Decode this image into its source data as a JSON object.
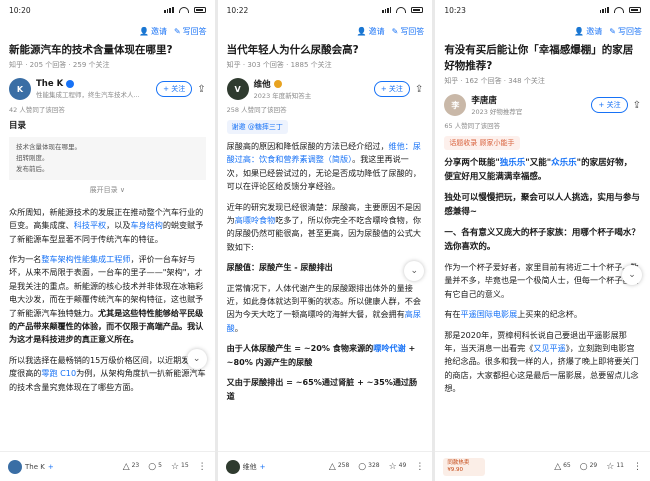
{
  "screens": [
    {
      "time": "10:20",
      "invite": "邀请",
      "write": "写回答",
      "question": "新能源汽车的技术含量体现在哪里?",
      "meta": "知乎 · 205 个回答 · 259 个关注",
      "author": "The K",
      "author_desc": "性能集成工程师，终生汽车技术人...",
      "follow": "+ 关注",
      "approve": "42 人赞同了该回答",
      "toc_title": "目录",
      "toc_items": [
        "技术含量体现在哪里。",
        "扭转刚度。",
        "发布前后。"
      ],
      "expand": "展开目录 ∨",
      "p1a": "众所周知，新能源技术的发展正在推动整个汽车行业的巨变。高集成度、",
      "p1_l1": "科技平权",
      "p1b": "，以及",
      "p1_l2": "车身结构",
      "p1c": "的蜕变赋予了新能源车型显著不同于传统汽车的特征。",
      "p2a": "作为一名",
      "p2_l1": "整车架构性能集成工程师",
      "p2b": "，评价一台车好与坏，从来不局限于表面，一台车的里子——\"架构\"，才是我关注的重点。新能源的核心技术并非体现在冰箱彩电大沙发，而在于颠覆传统汽车的架构特征，这也赋予了新能源汽车独特魅力。",
      "p2c": "尤其是这些特性能够给平民级的产品带来颠覆性的体验，而不仅限于高端产品。我认为这才是科技进步的真正意义所在。",
      "p3a": "所以我选择在最畅销的15万级价格区间，以近期发布热度很高的",
      "p3_l1": "零跑 C10",
      "p3b": "为例，从架构角度扒一扒新能源汽车的技术含量究竟体现在了哪些方面。",
      "bot_name": "The K",
      "bot_plus": "+",
      "bot_up": "23",
      "bot_comments": "5",
      "bot_stars": "15"
    },
    {
      "time": "10:22",
      "invite": "邀请",
      "write": "写回答",
      "question": "当代年轻人为什么尿酸会高?",
      "meta": "知乎 · 303 个回答 · 1885 个关注",
      "author": "维他",
      "author_desc": "2023 年度新知答主",
      "follow": "+ 关注",
      "approve": "258 人赞同了该回答",
      "mention": "谢邀 @糖摔三丁",
      "p1a": "尿酸高的原因和降低尿酸的方法已经介绍过，",
      "p1_l1": "维他：尿酸过高：饮食和营养素调整（简版）",
      "p1b": "。我这里再说一次，如果已经尝试过的，无论是否成功降低了尿酸的，可以在评论区给反馈分享经验。",
      "p2a": "近年的研究发现已经很清楚：尿酸高，主要原因不是因为",
      "p2_l1": "高嘌呤食物",
      "p2b": "吃多了，所以你完全不吃含嘌呤食物，你的尿酸仍然可能很高，甚至更高，因为尿酸值的公式大致如下:",
      "formula": "尿酸值：尿酸产生 - 尿酸排出",
      "p3a": "正常情况下，人体代谢产生的尿酸跟排出体外的量接近，如此身体就达到平衡的状态。所以健康人群，不会因为今天大吃了一顿高嘌呤的海鲜大餐，就会拥有",
      "p3_l1": "高尿酸",
      "p3b": "。",
      "p4a": "由于人体尿酸产生 = ~20% 食物来源的",
      "p4_l1": "嘌呤代谢",
      "p4b": " + ~80% 内源产生的尿酸",
      "p5": "又由于尿酸排出 = ~65%通过肾脏 + ~35%通过肠道",
      "bot_name": "维他",
      "bot_plus": "+",
      "bot_up": "258",
      "bot_comments": "328",
      "bot_stars": "49"
    },
    {
      "time": "10:23",
      "invite": "邀请",
      "write": "写回答",
      "question": "有没有买后能让你「幸福感爆棚」的家居好物推荐?",
      "meta": "知乎 · 162 个回答 · 348 个关注",
      "author": "李唐唐",
      "author_desc": "2023 好物推荐官",
      "follow": "+ 关注",
      "approve": "65 人赞同了该回答",
      "topic_tag": "话题收录 顾家小能手",
      "p1a": "分享两个既能\"",
      "p1_l1": "独乐乐",
      "p1b": "\"又能\"",
      "p1_l2": "众乐乐",
      "p1c": "\"的家居好物，",
      "p1d": "便宜好用又能满满幸福感。",
      "p2": "独处可以慢慢把玩，聚会可以人人挑选，实用与参与感兼得~",
      "h1": "一、各有意义又庞大的杯子家族：用哪个杯子喝水？选你喜欢的。",
      "p3": "作为一个杯子爱好者，家里目前有将近二十个杯子。数量并不多，毕竟也是一个极简人士，但每一个杯子都具有它自己的意义。",
      "p4a": "有在",
      "p4_l1": "平遥国际电影展",
      "p4b": "上买来的纪念杯。",
      "p5a": "那是2020年，贾樟柯科长说自己要退出平遥影展那年，当天消息一出看完《",
      "p5_l1": "又见平遥",
      "p5b": "》，立刻跑到电影宫抢纪念品。很多和我一样的人，挤爆了晚上即将要关门的商店，大家都担心这是最后一届影展，总要留点儿念想。",
      "shop_name": "同款热卖",
      "shop_price": "¥9.90",
      "bot_up": "65",
      "bot_comments": "29",
      "bot_stars": "11"
    }
  ]
}
